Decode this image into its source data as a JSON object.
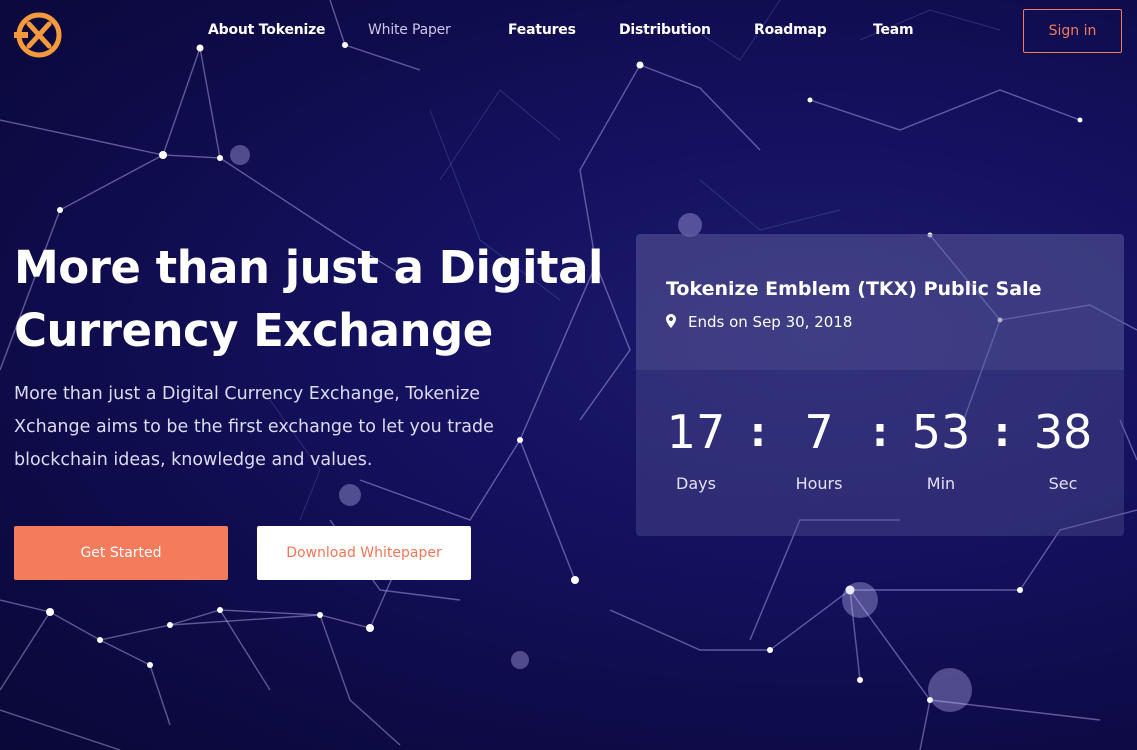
{
  "brand": {
    "logo_icon": "tokenize-x-logo",
    "accent": "#f47b5b"
  },
  "nav": {
    "items": [
      {
        "label": "About Tokenize"
      },
      {
        "label": "White Paper"
      },
      {
        "label": "Features"
      },
      {
        "label": "Distribution"
      },
      {
        "label": "Roadmap"
      },
      {
        "label": "Team"
      }
    ],
    "signin_label": "Sign in"
  },
  "hero": {
    "title_line1": "More than just a Digital",
    "title_line2": "Currency Exchange",
    "description": "More than just a Digital Currency Exchange, Tokenize Xchange aims to be the first exchange to let you trade blockchain ideas, knowledge and values.",
    "primary_button": "Get Started",
    "secondary_button": "Download Whitepaper"
  },
  "sale": {
    "title": "Tokenize Emblem (TKX) Public Sale",
    "ends": "Ends on Sep 30, 2018",
    "location_icon": "map-pin-icon",
    "countdown": [
      {
        "value": "17",
        "label": "Days"
      },
      {
        "value": "7",
        "label": "Hours"
      },
      {
        "value": "53",
        "label": "Min"
      },
      {
        "value": "38",
        "label": "Sec"
      }
    ],
    "separator": ":"
  }
}
